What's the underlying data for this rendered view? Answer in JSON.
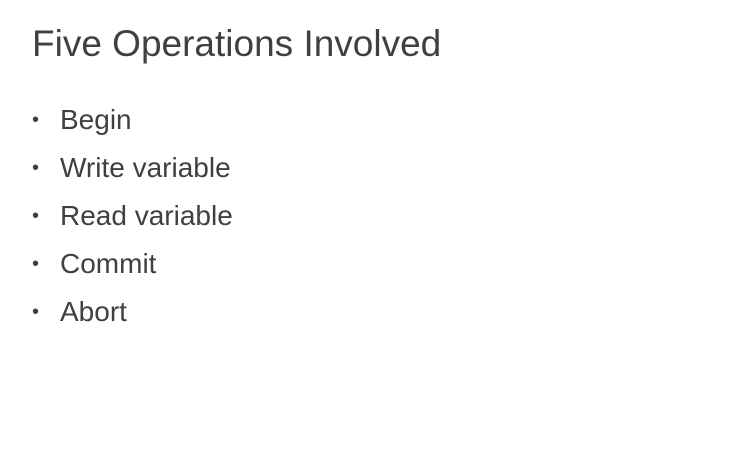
{
  "slide": {
    "title": "Five Operations Involved",
    "bullet_symbol": "•",
    "items": [
      {
        "label": "Begin"
      },
      {
        "label": "Write variable"
      },
      {
        "label": "Read variable"
      },
      {
        "label": "Commit"
      },
      {
        "label": "Abort"
      }
    ]
  },
  "colors": {
    "text": "#404040",
    "background": "#ffffff"
  }
}
